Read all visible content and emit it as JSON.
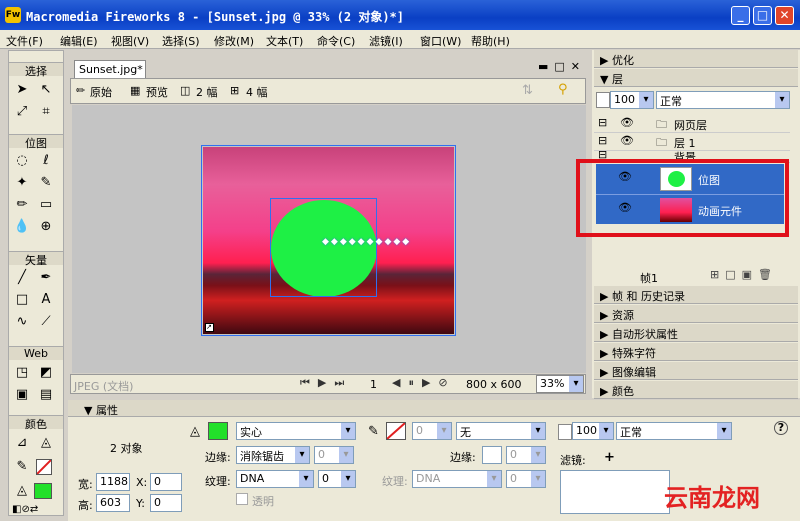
{
  "window": {
    "title": "Macromedia Fireworks 8 - [Sunset.jpg @  33% (2 对象)*]",
    "icon": "Fw",
    "minimize": "_",
    "maximize": "□",
    "close": "✕"
  },
  "menu": [
    "文件(F)",
    "编辑(E)",
    "视图(V)",
    "选择(S)",
    "修改(M)",
    "文本(T)",
    "命令(C)",
    "滤镜(I)",
    "窗口(W)",
    "帮助(H)"
  ],
  "tools": {
    "select": "选择",
    "bitmap": "位图",
    "vector": "矢量",
    "web": "Web",
    "colors": "颜色",
    "fill_color": "#22e02a",
    "stroke_color": "#e02020"
  },
  "document": {
    "tab": "Sunset.jpg*",
    "views": [
      "原始",
      "预览",
      "2 幅",
      "4 幅"
    ],
    "status_format": "JPEG (文档)",
    "frame": "1",
    "size": "800 x 600",
    "zoom": "33%"
  },
  "panels": {
    "optimize": "优化",
    "layers": "层",
    "opacity": "100",
    "blend": "正常",
    "layer_web": "网页层",
    "layer_1": "层 1",
    "layer_bg": "背景",
    "object_bitmap": "位图",
    "object_anim": "动画元件",
    "frame_label": "帧1",
    "frames_history": "帧 和 历史记录",
    "assets": "资源",
    "autoshape": "自动形状属性",
    "special_chars": "特殊字符",
    "image_edit": "图像编辑",
    "color": "颜色"
  },
  "properties": {
    "header": "属性",
    "object_count": "2 对象",
    "fill_type": "实心",
    "edge_label": "边缘:",
    "edge_value": "消除锯齿",
    "edge_num": "0",
    "texture_label": "纹理:",
    "texture_value": "DNA",
    "texture_num": "0",
    "transparent": "透明",
    "stroke_size": "0",
    "stroke_type": "无",
    "stroke_edge_label": "边缘:",
    "stroke_edge_num": "0",
    "stroke_texture_label": "纹理:",
    "stroke_texture_value": "DNA",
    "stroke_texture_num": "0",
    "opacity": "100",
    "blend": "正常",
    "filters_label": "滤镜:",
    "w_label": "宽:",
    "w": "1188",
    "h_label": "高:",
    "h": "603",
    "x_label": "X:",
    "x": "0",
    "y_label": "Y:",
    "y": "0",
    "help": "?"
  },
  "watermark": "云南龙网"
}
